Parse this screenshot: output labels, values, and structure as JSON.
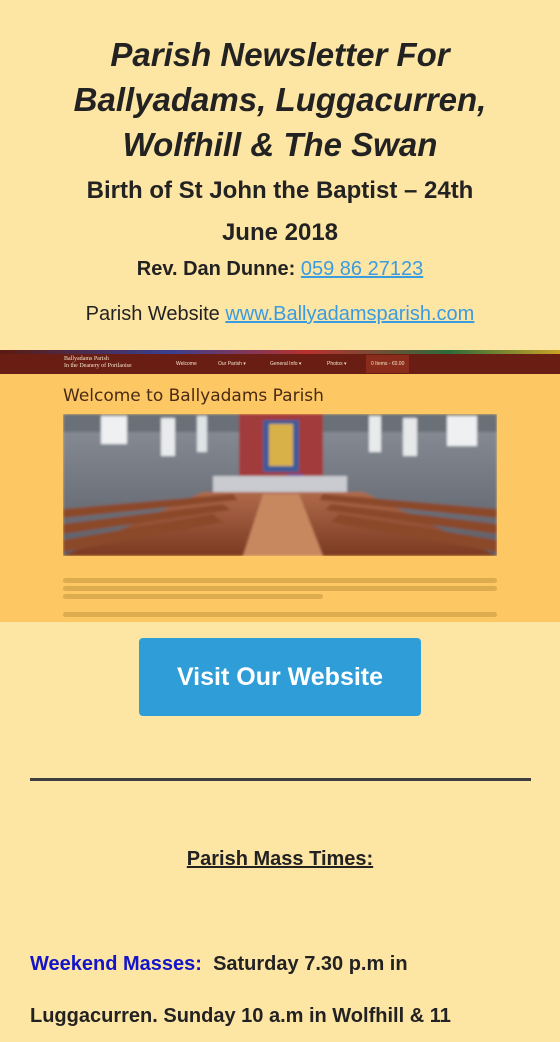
{
  "header": {
    "title_line1": "Parish Newsletter For",
    "title_line2": "Ballyadams, Luggacurren,",
    "title_line3": "Wolfhill & The Swan",
    "subtitle_line1": "Birth of St John the Baptist – 24th",
    "subtitle_line2": "June 2018",
    "priest_label": "Rev. Dan Dunne:",
    "priest_phone": "059 86 27123",
    "website_label": "Parish Website",
    "website_link": "www.Ballyadamsparish.com"
  },
  "screenshot": {
    "brand_line1": "Ballyadams Parish",
    "brand_line2": "In the Deanery of Portlaoise",
    "nav_items": [
      "Welcome",
      "Our Parish ▾",
      "General Info ▾",
      "Photos ▾"
    ],
    "nav_active": "0 Items - €0.00",
    "heading": "Welcome to Ballyadams Parish"
  },
  "cta": {
    "label": "Visit Our Website"
  },
  "mass_times": {
    "title": "Parish Mass Times:",
    "lead": "Weekend Masses:",
    "line1": "Saturday 7.30 p.m in",
    "line2": "Luggacurren. Sunday 10 a.m in Wolfhill & 11"
  },
  "colors": {
    "background": "#fde5a3",
    "link": "#3b9be0",
    "button": "#2f9ed8",
    "lead": "#1414c8"
  }
}
